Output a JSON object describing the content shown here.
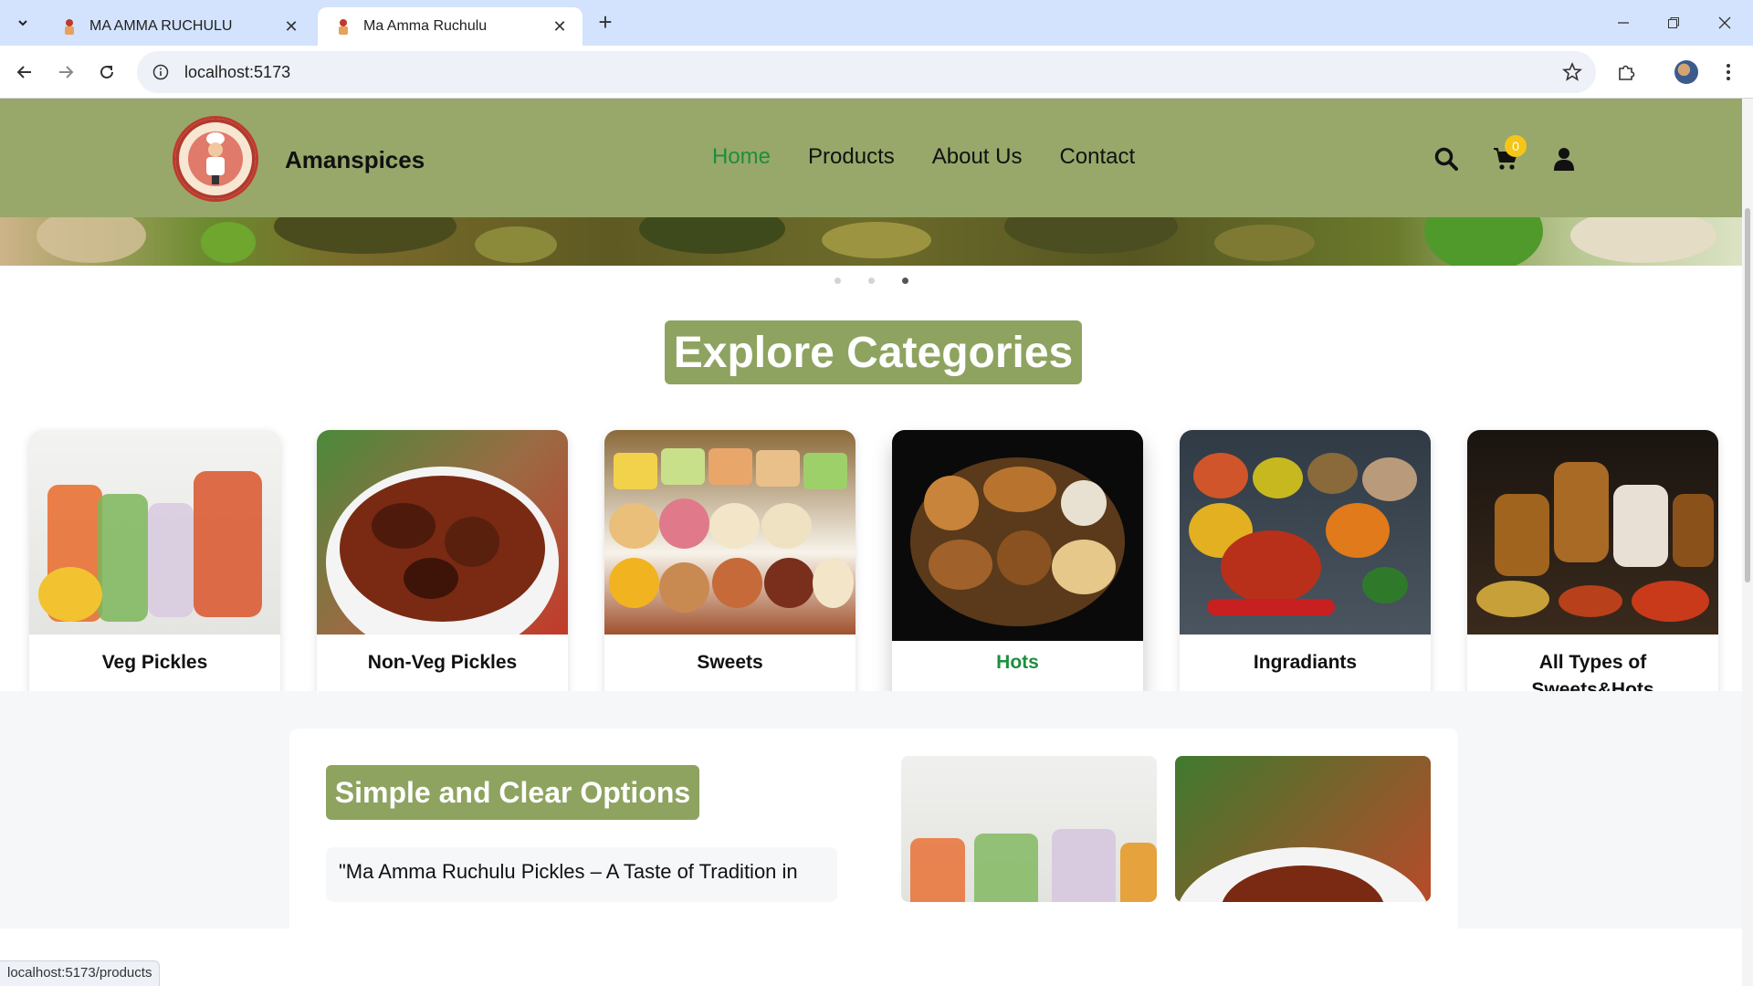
{
  "browser": {
    "tabs": [
      {
        "title": "MA AMMA RUCHULU",
        "active": false
      },
      {
        "title": "Ma Amma Ruchulu",
        "active": true
      }
    ],
    "url": "localhost:5173",
    "status_url": "localhost:5173/products"
  },
  "site": {
    "brand": "Amanspices",
    "nav": [
      "Home",
      "Products",
      "About Us",
      "Contact"
    ],
    "active_nav": "Home",
    "cart_count": "0",
    "colors": {
      "header": "#97a86a",
      "accent": "#1e8e3e",
      "badge": "#f5c518",
      "title_bg": "#8ea360"
    }
  },
  "carousel": {
    "slides": 3,
    "active_slide": 3
  },
  "explore": {
    "title": "Explore Categories",
    "categories": [
      {
        "label": "Veg Pickles"
      },
      {
        "label": "Non-Veg Pickles"
      },
      {
        "label": "Sweets"
      },
      {
        "label": "Hots",
        "hovered": true
      },
      {
        "label": "Ingradiants"
      },
      {
        "label": "All Types of Sweets&Hots"
      }
    ]
  },
  "options": {
    "title": "Simple and Clear Options",
    "quote": "\"Ma Amma Ruchulu Pickles – A Taste of Tradition in"
  }
}
